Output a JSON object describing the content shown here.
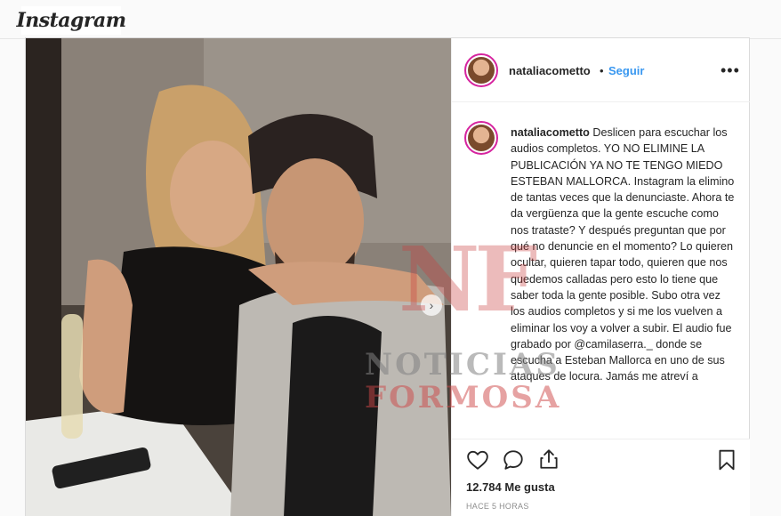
{
  "brand": {
    "logo_text": "Instagram"
  },
  "post": {
    "author": "nataliacometto",
    "dot": "•",
    "follow_label": "Seguir",
    "more_label": "•••",
    "caption": {
      "username": "nataliacometto",
      "text": "Deslicen para escuchar los audios completos. YO NO ELIMINE LA PUBLICACIÓN YA NO TE TENGO MIEDO ESTEBAN MALLORCA. Instagram la elimino de tantas veces que la denunciaste. Ahora te da vergüenza que la gente escuche como nos trataste? Y después preguntan que por qué no denuncie en el momento? Lo quieren ocultar, quieren tapar todo, quieren que nos quedemos calladas pero esto lo tiene que saber toda la gente posible. Subo otra vez los audios completos y si me los vuelven a eliminar los voy a volver a subir. El audio fue grabado por @camilaserra._ donde se escucha a Esteban Mallorca en uno de sus ataques de locura. Jamás me atreví a"
    },
    "likes": "12.784 Me gusta",
    "time": "HACE 5 HORAS",
    "icons": {
      "like": "heart-icon",
      "comment": "comment-icon",
      "share": "share-icon",
      "save": "bookmark-icon",
      "next": "chevron-right-icon"
    },
    "next_glyph": "›"
  },
  "watermark": {
    "logo": "NF",
    "line1": "NOTICIAS",
    "line2": "FORMOSA"
  },
  "colors": {
    "link": "#3897f0",
    "text": "#262626",
    "muted": "#8e8e8e",
    "border": "#dbdbdb"
  }
}
